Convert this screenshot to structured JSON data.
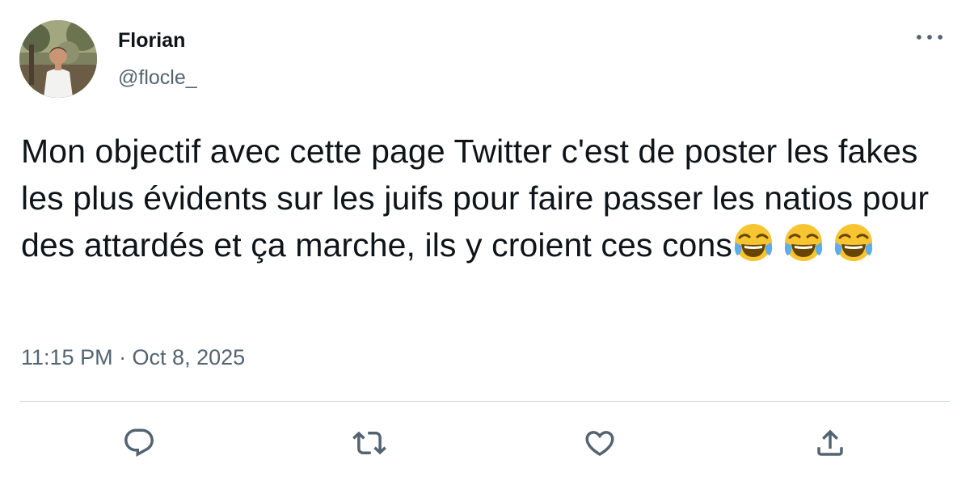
{
  "author": {
    "display_name": "Florian",
    "handle": "@flocle_",
    "avatar_icon": "profile-photo"
  },
  "tweet": {
    "text": "Mon objectif avec cette page Twitter c'est de poster les fakes les plus évidents sur les juifs pour faire passer les natios pour des attardés et ça marche, ils y croient ces cons",
    "emojis": [
      "face-with-tears-of-joy",
      "face-with-tears-of-joy",
      "face-with-tears-of-joy"
    ],
    "timestamp": "11:15 PM · Oct 8, 2025"
  },
  "actions": {
    "more_icon": "more-horizontal-icon",
    "reply_icon": "reply-icon",
    "retweet_icon": "retweet-icon",
    "like_icon": "heart-icon",
    "share_icon": "share-icon"
  },
  "colors": {
    "primary_text": "#0f1419",
    "secondary_text": "#536471",
    "divider": "#cfd9de",
    "icon": "#536471",
    "background": "#ffffff"
  }
}
